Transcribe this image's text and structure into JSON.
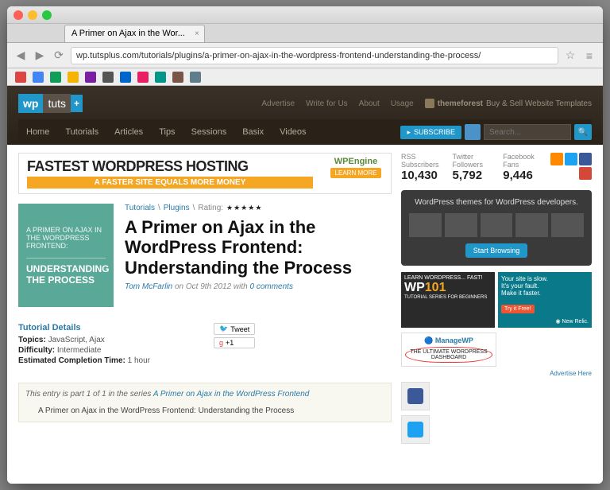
{
  "browser": {
    "tab_title": "A Primer on Ajax in the Wor...",
    "url": "wp.tutsplus.com/tutorials/plugins/a-primer-on-ajax-in-the-wordpress-frontend-understanding-the-process/"
  },
  "header": {
    "logo_wp": "wp",
    "logo_tuts": "tuts",
    "logo_plus": "+",
    "top_links": [
      "Advertise",
      "Write for Us",
      "About",
      "Usage"
    ],
    "themeforest_label": "themeforest",
    "themeforest_tag": "Buy & Sell Website Templates",
    "nav": [
      "Home",
      "Tutorials",
      "Articles",
      "Tips",
      "Sessions",
      "Basix",
      "Videos"
    ],
    "subscribe": "SUBSCRIBE",
    "search_placeholder": "Search..."
  },
  "banner": {
    "title": "FASTEST WORDPRESS HOSTING",
    "subtitle": "A FASTER SITE EQUALS MORE MONEY",
    "brand": "WPEngine",
    "cta": "LEARN MORE"
  },
  "article": {
    "thumb_line1": "A PRIMER ON AJAX IN THE WORDPRESS FRONTEND:",
    "thumb_line2": "UNDERSTANDING THE PROCESS",
    "crumb1": "Tutorials",
    "crumb2": "Plugins",
    "rating_label": "Rating:",
    "title": "A Primer on Ajax in the WordPress Frontend: Understanding the Process",
    "author": "Tom McFarlin",
    "date": "Oct 9th 2012",
    "comments": "0 comments",
    "byline_on": " on ",
    "byline_with": " with "
  },
  "details": {
    "heading": "Tutorial Details",
    "topics_label": "Topics:",
    "topics": "JavaScript, Ajax",
    "difficulty_label": "Difficulty:",
    "difficulty": "Intermediate",
    "time_label": "Estimated Completion Time:",
    "time": "1 hour",
    "tweet": "Tweet",
    "gplus": "+1"
  },
  "series": {
    "intro": "This entry is part 1 of 1 in the series ",
    "link": "A Primer on Ajax in the WordPress Frontend",
    "item": "A Primer on Ajax in the WordPress Frontend: Understanding the Process"
  },
  "sidebar": {
    "stats": [
      {
        "label": "RSS Subscribers",
        "value": "10,430"
      },
      {
        "label": "Twitter Followers",
        "value": "5,792"
      },
      {
        "label": "Facebook Fans",
        "value": "9,446"
      }
    ],
    "promo_title": "WordPress themes for WordPress developers.",
    "promo_cta": "Start Browsing",
    "ad1_top": "LEARN WORDPRESS... FAST!",
    "ad1_mid_wp": "WP",
    "ad1_mid_101": "101",
    "ad1_bot": "TUTORIAL SERIES FOR BEGINNERS",
    "ad2_l1": "Your site is slow.",
    "ad2_l2": "It's your fault.",
    "ad2_l3": "Make it faster.",
    "ad2_try": "Try it Free!",
    "ad2_brand": "New Relic.",
    "ad3_brand": "ManageWP",
    "ad3_tag": "THE ULTIMATE WORDPRESS DASHBOARD",
    "advertise_here": "Advertise Here"
  }
}
